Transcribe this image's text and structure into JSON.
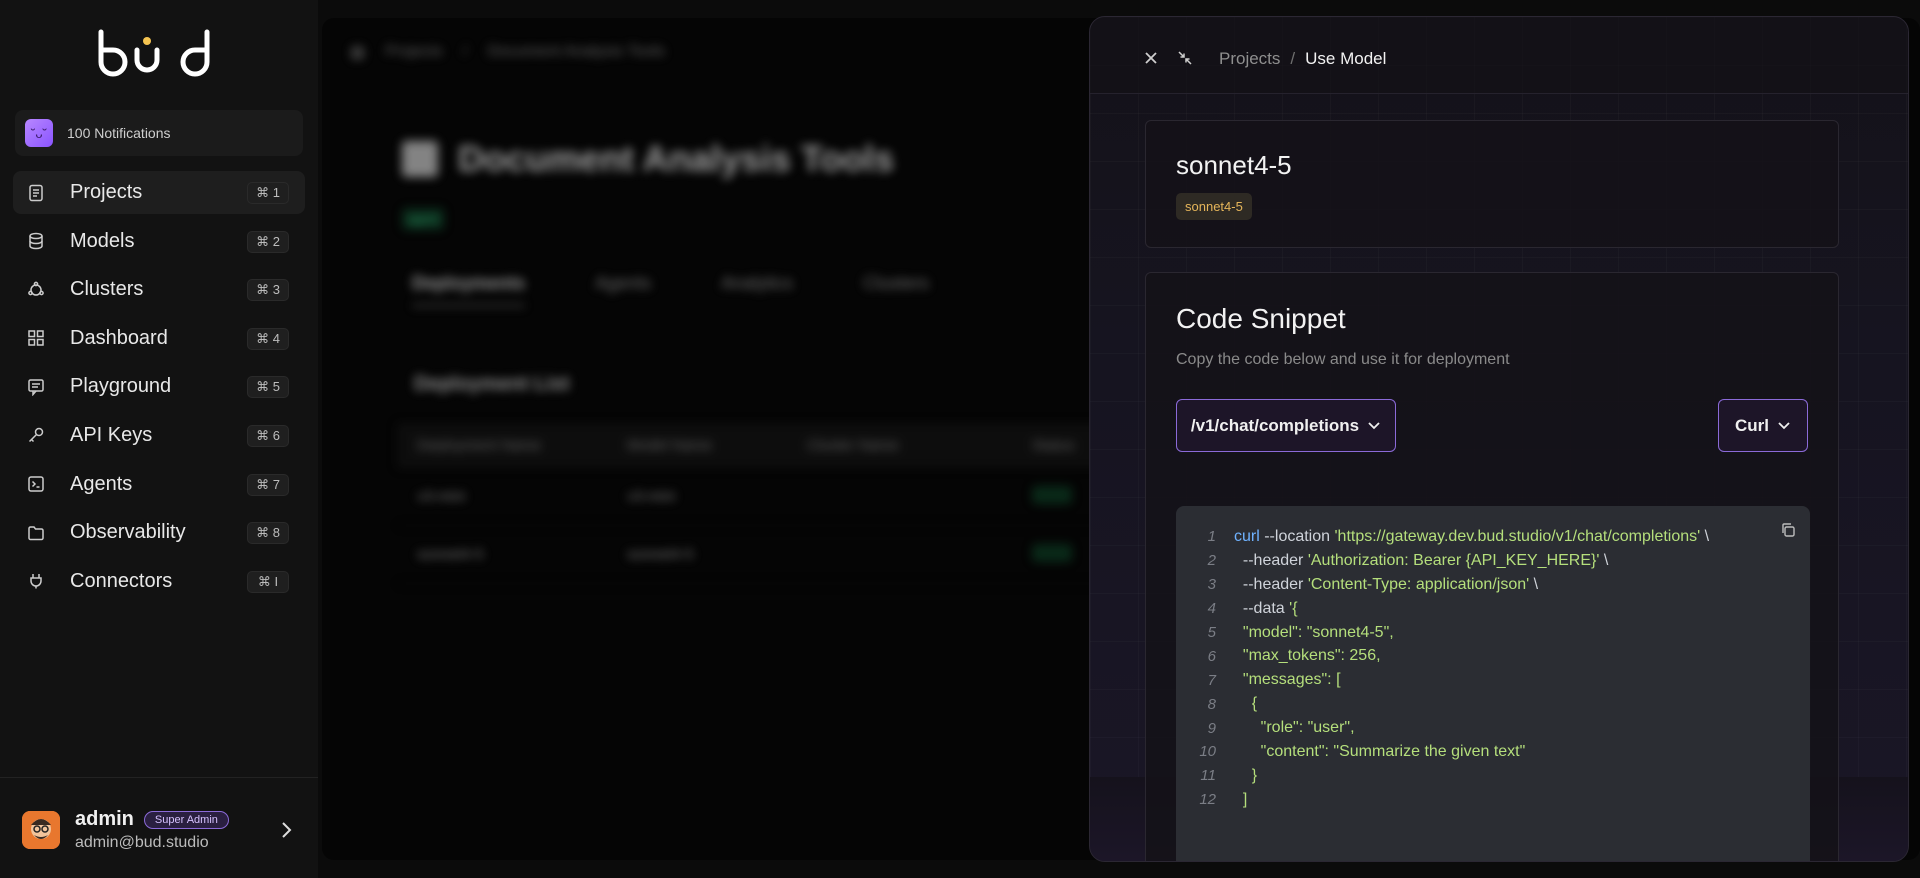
{
  "sidebar": {
    "logo_text": "bud",
    "notifications": {
      "label": "100 Notifications"
    },
    "items": [
      {
        "label": "Projects",
        "shortcut": "⌘ 1",
        "icon": "document-icon",
        "active": true
      },
      {
        "label": "Models",
        "shortcut": "⌘ 2",
        "icon": "database-icon",
        "active": false
      },
      {
        "label": "Clusters",
        "shortcut": "⌘ 3",
        "icon": "cluster-icon",
        "active": false
      },
      {
        "label": "Dashboard",
        "shortcut": "⌘ 4",
        "icon": "grid-icon",
        "active": false
      },
      {
        "label": "Playground",
        "shortcut": "⌘ 5",
        "icon": "chat-icon",
        "active": false
      },
      {
        "label": "API Keys",
        "shortcut": "⌘ 6",
        "icon": "key-icon",
        "active": false
      },
      {
        "label": "Agents",
        "shortcut": "⌘ 7",
        "icon": "terminal-icon",
        "active": false
      },
      {
        "label": "Observability",
        "shortcut": "⌘ 8",
        "icon": "folder-icon",
        "active": false
      },
      {
        "label": "Connectors",
        "shortcut": "⌘ I",
        "icon": "plug-icon",
        "active": false
      }
    ],
    "user": {
      "name": "admin",
      "role": "Super Admin",
      "email": "admin@bud.studio"
    }
  },
  "background": {
    "breadcrumb": [
      "Projects",
      "Document Analysis Tools"
    ],
    "title": "Document Analysis Tools",
    "tag": "agent",
    "tabs": [
      "Deployments",
      "Agents",
      "Analytics",
      "Clusters"
    ],
    "list_title": "Deployment List",
    "columns": [
      "Deployment Name",
      "Model Name",
      "Cluster Name",
      "Status"
    ],
    "rows": [
      [
        "v3-mini",
        "v3-mini",
        "",
        ""
      ],
      [
        "sonnet4-5",
        "sonnet4-5",
        "",
        ""
      ]
    ]
  },
  "drawer": {
    "breadcrumb": {
      "parent": "Projects",
      "separator": "/",
      "current": "Use Model"
    },
    "model": {
      "name": "sonnet4-5",
      "tag": "sonnet4-5"
    },
    "snippet": {
      "title": "Code Snippet",
      "subtitle": "Copy the code below and use it for deployment",
      "endpoint": "/v1/chat/completions",
      "language": "Curl"
    },
    "code_lines": [
      {
        "n": "1",
        "parts": [
          [
            "k",
            "curl"
          ],
          [
            "o",
            " --location "
          ],
          [
            "s",
            "'https://gateway.dev.bud.studio/v1/chat/completions'"
          ],
          [
            "o",
            " \\"
          ]
        ]
      },
      {
        "n": "2",
        "parts": [
          [
            "o",
            "  --header "
          ],
          [
            "s",
            "'Authorization: Bearer {API_KEY_HERE}'"
          ],
          [
            "o",
            " \\"
          ]
        ]
      },
      {
        "n": "3",
        "parts": [
          [
            "o",
            "  --header "
          ],
          [
            "s",
            "'Content-Type: application/json'"
          ],
          [
            "o",
            " \\"
          ]
        ]
      },
      {
        "n": "4",
        "parts": [
          [
            "o",
            "  --data "
          ],
          [
            "s",
            "'{"
          ]
        ]
      },
      {
        "n": "5",
        "parts": [
          [
            "s",
            "  \"model\": \"sonnet4-5\","
          ]
        ]
      },
      {
        "n": "6",
        "parts": [
          [
            "s",
            "  \"max_tokens\": 256,"
          ]
        ]
      },
      {
        "n": "7",
        "parts": [
          [
            "s",
            "  \"messages\": ["
          ]
        ]
      },
      {
        "n": "8",
        "parts": [
          [
            "s",
            "    {"
          ]
        ]
      },
      {
        "n": "9",
        "parts": [
          [
            "s",
            "      \"role\": \"user\","
          ]
        ]
      },
      {
        "n": "10",
        "parts": [
          [
            "s",
            "      \"content\": \"Summarize the given text\""
          ]
        ]
      },
      {
        "n": "11",
        "parts": [
          [
            "s",
            "    }"
          ]
        ]
      },
      {
        "n": "12",
        "parts": [
          [
            "s",
            "  ]"
          ]
        ]
      }
    ]
  }
}
